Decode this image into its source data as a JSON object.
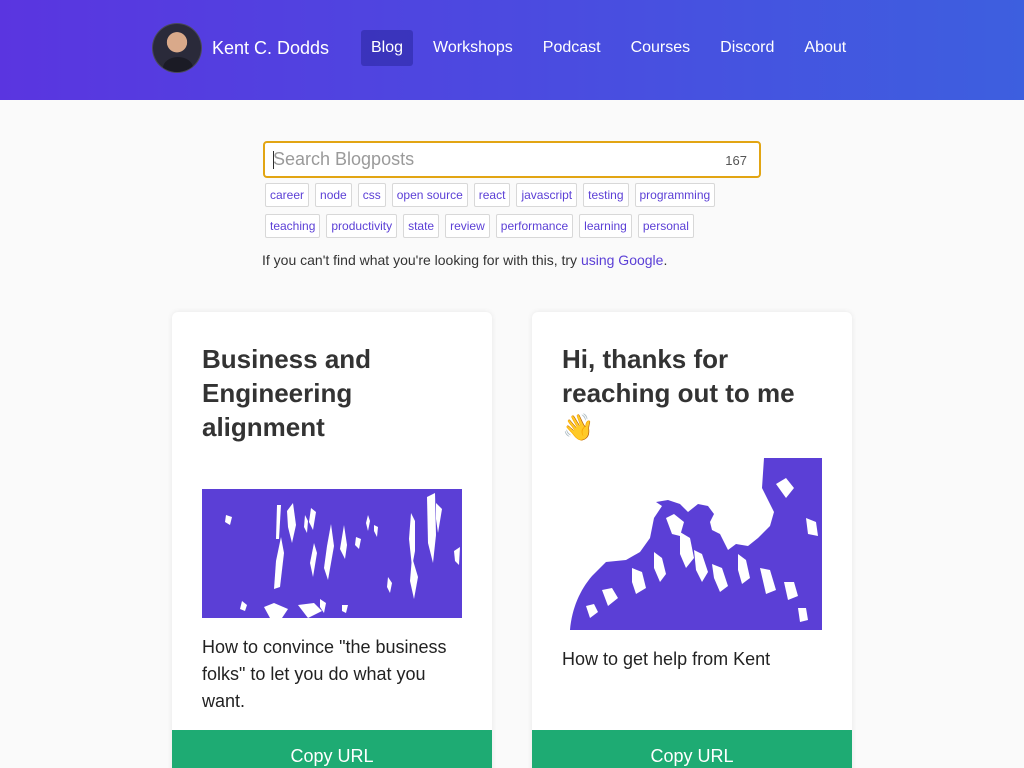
{
  "header": {
    "brand_name": "Kent C. Dodds",
    "nav": [
      {
        "label": "Blog",
        "active": true
      },
      {
        "label": "Workshops"
      },
      {
        "label": "Podcast"
      },
      {
        "label": "Courses"
      },
      {
        "label": "Discord"
      },
      {
        "label": "About"
      }
    ]
  },
  "search": {
    "placeholder": "Search Blogposts",
    "value": "",
    "count": "167"
  },
  "tags": {
    "row1": [
      "career",
      "node",
      "css",
      "open source",
      "react",
      "javascript",
      "testing",
      "programming"
    ],
    "row2": [
      "teaching",
      "productivity",
      "state",
      "review",
      "performance",
      "learning",
      "personal"
    ]
  },
  "hint": {
    "text": "If you can't find what you're looking for with this, try",
    "link": "using Google",
    "suffix": "."
  },
  "cards": [
    {
      "title": "Business and Engineering alignment",
      "description": "How to convince \"the business folks\" to let you do what you want.",
      "button": "Copy URL"
    },
    {
      "title": "Hi, thanks for reaching out to me",
      "emoji": "👋",
      "description": "How to get help from Kent",
      "button": "Copy URL"
    }
  ],
  "colors": {
    "accent": "#5b3fd6",
    "button": "#1eab73",
    "search_border": "#e2a513"
  }
}
